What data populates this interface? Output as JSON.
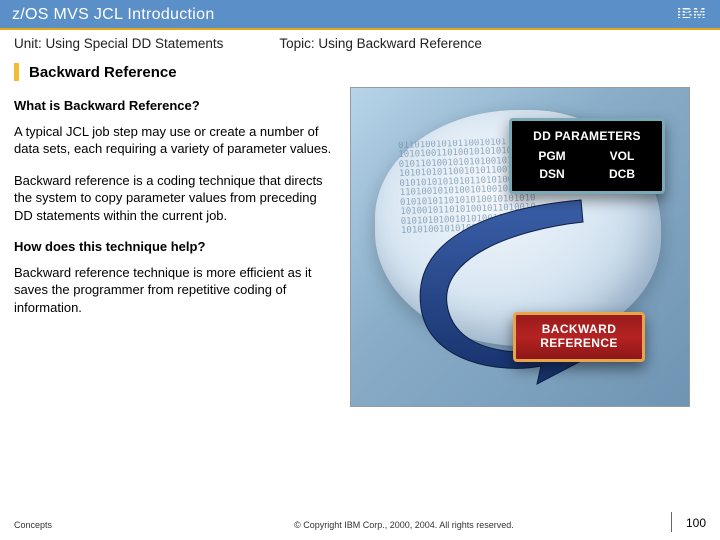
{
  "header": {
    "title": "z/OS MVS JCL Introduction",
    "logo_text": "IBM"
  },
  "meta": {
    "unit": "Unit: Using Special DD Statements",
    "topic": "Topic: Using Backward Reference"
  },
  "section": {
    "title": "Backward Reference"
  },
  "content": {
    "q1": "What is Backward Reference?",
    "p1": "A typical JCL job step may use or create a number of data sets, each requiring a variety of parameter values.",
    "p2": "Backward reference is a coding technique that directs the system to copy parameter values from preceding DD statements within the current job.",
    "q2": "How does this technique help?",
    "p3": "Backward reference technique is more efficient as it saves the programmer from repetitive coding of information."
  },
  "figure": {
    "dd_title": "DD PARAMETERS",
    "dd_params": {
      "a": "PGM",
      "b": "VOL",
      "c": "DSN",
      "d": "DCB"
    },
    "br_label": "BACKWARD REFERENCE",
    "binary_fill": "01101001010110010101\n1010100110100101010101\n01011010010101010010101\n101010101100101011001010\n0101010101010110101001101\n11010010101001010010110100\n0101010110101010010101010\n1010010110101001011010010\n010101010010101001011010\n10101001010100101010010"
  },
  "footer": {
    "left": "Concepts",
    "mid": "© Copyright IBM Corp., 2000, 2004. All rights reserved.",
    "page": "100"
  }
}
